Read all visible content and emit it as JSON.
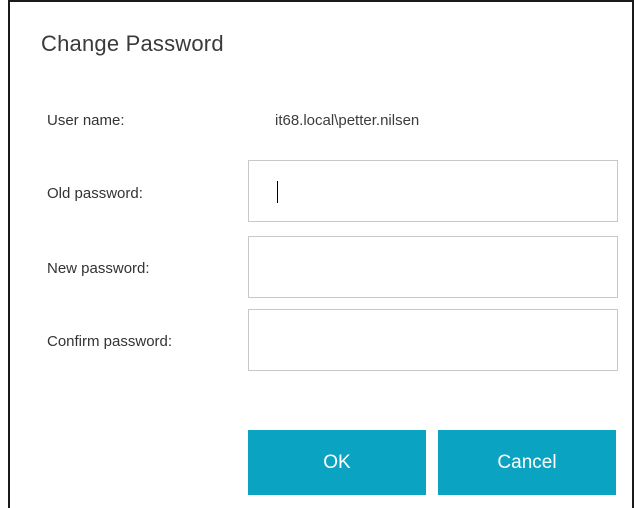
{
  "dialog": {
    "title": "Change Password",
    "user_name_label": "User name:",
    "user_name_value": "it68.local\\petter.nilsen",
    "old_password_label": "Old password:",
    "new_password_label": "New password:",
    "confirm_password_label": "Confirm password:",
    "old_password_value": "",
    "new_password_value": "",
    "confirm_password_value": ""
  },
  "buttons": {
    "ok_label": "OK",
    "cancel_label": "Cancel"
  },
  "colors": {
    "button_bg": "#0ba3c2",
    "button_text": "#ffffff",
    "field_border": "#c8c8c8"
  }
}
